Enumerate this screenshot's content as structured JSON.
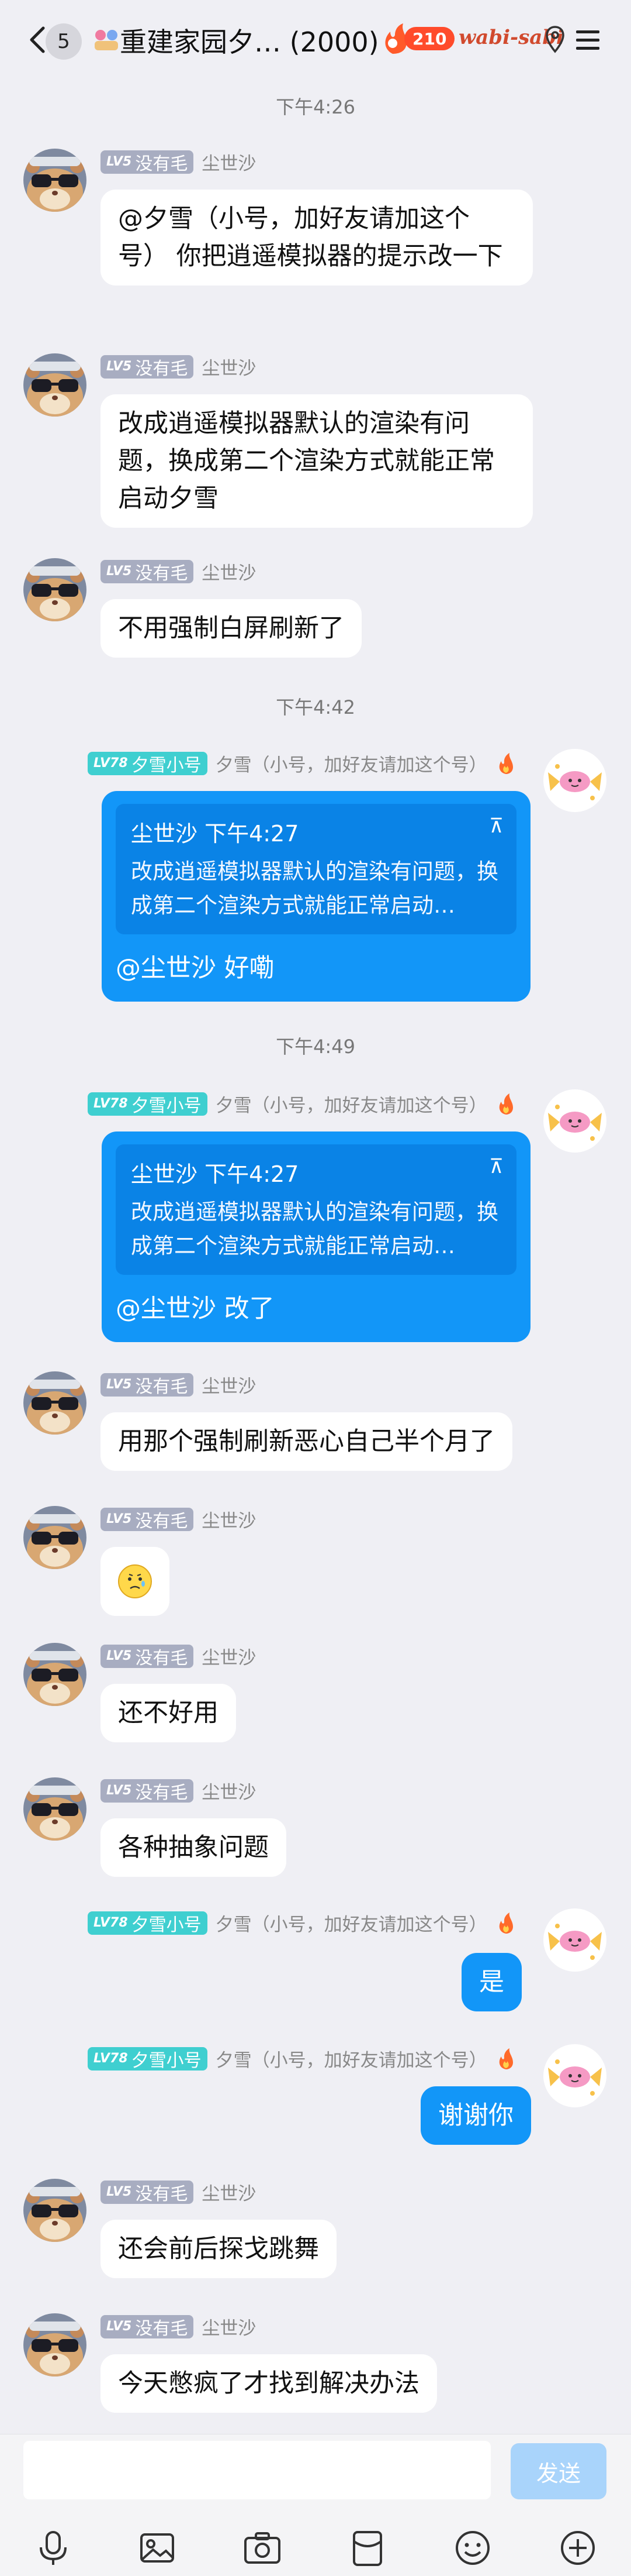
{
  "header": {
    "back_count": "5",
    "title": "重建家园夕… (2000)",
    "fire_count": "210",
    "brand": "wabi-sabi"
  },
  "users": {
    "a": {
      "level": "LV5",
      "title": "没有毛",
      "name": "尘世沙"
    },
    "b": {
      "level": "LV78",
      "title": "夕雪小号",
      "name": "夕雪（小号，加好友请加这个号）"
    }
  },
  "messages": {
    "t1": "下午4:26",
    "m1": "@夕雪（小号，加好友请加这个号） 你把逍遥模拟器的提示改一下",
    "m2": "改成逍遥模拟器默认的渲染有问题，换成第二个渲染方式就能正常启动夕雪",
    "m3": "不用强制白屏刷新了",
    "t2": "下午4:42",
    "q1_head": "尘世沙  下午4:27",
    "q1_text": "改成逍遥模拟器默认的渲染有问题，换成第二个渲染方式就能正常启动…",
    "m4": "@尘世沙 好嘞",
    "t3": "下午4:49",
    "q2_head": "尘世沙  下午4:27",
    "q2_text": "改成逍遥模拟器默认的渲染有问题，换成第二个渲染方式就能正常启动…",
    "m5": "@尘世沙 改了",
    "m6": "用那个强制刷新恶心自己半个月了",
    "m8": "还不好用",
    "m9": "各种抽象问题",
    "m10": "是",
    "m11": "谢谢你",
    "m12": "还会前后探戈跳舞",
    "m13": "今天憋疯了才找到解决办法"
  },
  "composer": {
    "send_label": "发送"
  },
  "toolbar": [
    "microphone-icon",
    "image-icon",
    "camera-icon",
    "red-packet-icon",
    "emoji-icon",
    "plus-icon"
  ]
}
